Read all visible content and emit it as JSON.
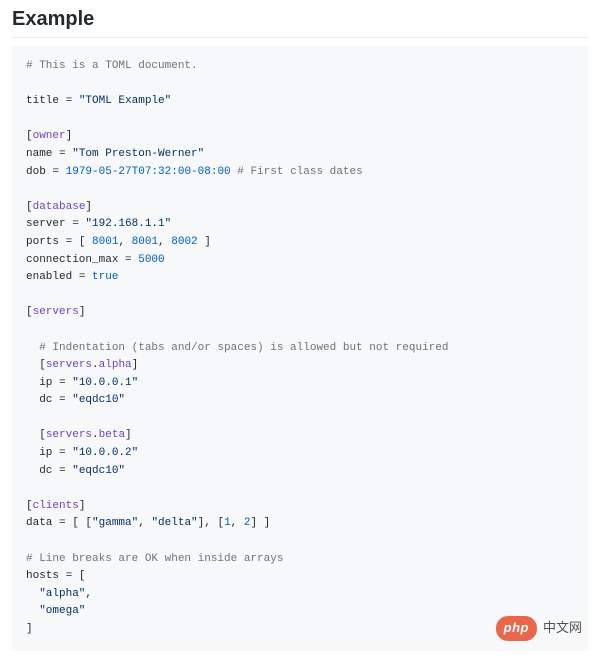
{
  "heading": "Example",
  "code": {
    "l1_comment": "# This is a TOML document.",
    "l2_key": "title",
    "l2_eq": " = ",
    "l2_val": "\"TOML Example\"",
    "l3_lb": "[",
    "l3_table": "owner",
    "l3_rb": "]",
    "l4_key": "name",
    "l4_eq": " = ",
    "l4_val": "\"Tom Preston-Werner\"",
    "l5_key": "dob",
    "l5_eq": " = ",
    "l5_val": "1979-05-27T07:32:00-08:00",
    "l5_comment": " # First class dates",
    "l6_lb": "[",
    "l6_table": "database",
    "l6_rb": "]",
    "l7_key": "server",
    "l7_eq": " = ",
    "l7_val": "\"192.168.1.1\"",
    "l8_key": "ports",
    "l8_eq": " = [ ",
    "l8_v1": "8001",
    "l8_c1": ", ",
    "l8_v2": "8001",
    "l8_c2": ", ",
    "l8_v3": "8002",
    "l8_end": " ]",
    "l9_key": "connection_max",
    "l9_eq": " = ",
    "l9_val": "5000",
    "l10_key": "enabled",
    "l10_eq": " = ",
    "l10_val": "true",
    "l11_lb": "[",
    "l11_table": "servers",
    "l11_rb": "]",
    "l12_indent": "  ",
    "l12_comment": "# Indentation (tabs and/or spaces) is allowed but not required",
    "l13_indent": "  ",
    "l13_lb": "[",
    "l13_p1": "servers",
    "l13_dot": ".",
    "l13_p2": "alpha",
    "l13_rb": "]",
    "l14_indent": "  ",
    "l14_key": "ip",
    "l14_eq": " = ",
    "l14_val": "\"10.0.0.1\"",
    "l15_indent": "  ",
    "l15_key": "dc",
    "l15_eq": " = ",
    "l15_val": "\"eqdc10\"",
    "l16_indent": "  ",
    "l16_lb": "[",
    "l16_p1": "servers",
    "l16_dot": ".",
    "l16_p2": "beta",
    "l16_rb": "]",
    "l17_indent": "  ",
    "l17_key": "ip",
    "l17_eq": " = ",
    "l17_val": "\"10.0.0.2\"",
    "l18_indent": "  ",
    "l18_key": "dc",
    "l18_eq": " = ",
    "l18_val": "\"eqdc10\"",
    "l19_lb": "[",
    "l19_table": "clients",
    "l19_rb": "]",
    "l20_key": "data",
    "l20_eq": " = [ [",
    "l20_s1": "\"gamma\"",
    "l20_c1": ", ",
    "l20_s2": "\"delta\"",
    "l20_mid": "], [",
    "l20_n1": "1",
    "l20_c2": ", ",
    "l20_n2": "2",
    "l20_end": "] ]",
    "l21_comment": "# Line breaks are OK when inside arrays",
    "l22_key": "hosts",
    "l22_eq": " = [",
    "l23_indent": "  ",
    "l23_val": "\"alpha\"",
    "l23_c": ",",
    "l24_indent": "  ",
    "l24_val": "\"omega\"",
    "l25": "]"
  },
  "watermark": {
    "badge": "php",
    "text": "中文网"
  }
}
